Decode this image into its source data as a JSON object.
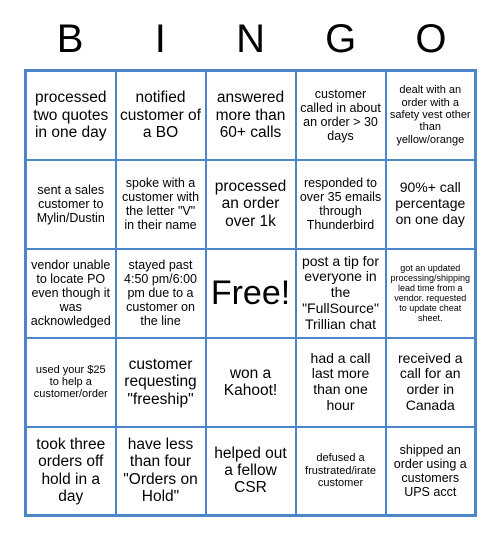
{
  "card": {
    "title": "BINGO",
    "header_letters": [
      "B",
      "I",
      "N",
      "G",
      "O"
    ],
    "border_color": "#4a86c8",
    "text_color": "#000000",
    "background_color": "#ffffff",
    "rows": 5,
    "columns": 5,
    "cells": [
      [
        {
          "text": "processed two quotes in one day",
          "size": "lg"
        },
        {
          "text": "notified customer of a BO",
          "size": "lg"
        },
        {
          "text": "answered more than 60+ calls",
          "size": "lg"
        },
        {
          "text": "customer called in about an order > 30 days",
          "size": "sm"
        },
        {
          "text": "dealt with an order with a safety vest other than yellow/orange",
          "size": "xs"
        }
      ],
      [
        {
          "text": "sent a sales customer to Mylin/Dustin",
          "size": "sm"
        },
        {
          "text": "spoke with a customer with the letter \"V\" in their name",
          "size": "sm"
        },
        {
          "text": "processed an order over 1k",
          "size": "lg"
        },
        {
          "text": "responded to over 35 emails through Thunderbird",
          "size": "sm"
        },
        {
          "text": "90%+ call percentage on one day",
          "size": "md"
        }
      ],
      [
        {
          "text": "vendor unable to locate PO even though it was acknowledged",
          "size": "sm"
        },
        {
          "text": "stayed past 4:50 pm/6:00 pm due to a customer on the line",
          "size": "sm"
        },
        {
          "text": "Free!",
          "size": "xl"
        },
        {
          "text": "post a tip for everyone in the \"FullSource\" Trillian chat",
          "size": "md"
        },
        {
          "text": "got an updated processing/shipping lead time from a vendor. requested to update cheat sheet.",
          "size": "xxs"
        }
      ],
      [
        {
          "text": "used your $25 to help a customer/order",
          "size": "xs"
        },
        {
          "text": "customer requesting \"freeship\"",
          "size": "lg"
        },
        {
          "text": "won a Kahoot!",
          "size": "lg"
        },
        {
          "text": "had a call last more than one hour",
          "size": "md"
        },
        {
          "text": "received a call for an order in Canada",
          "size": "md"
        }
      ],
      [
        {
          "text": "took three orders off hold in a day",
          "size": "lg"
        },
        {
          "text": "have less than four \"Orders on Hold\"",
          "size": "lg"
        },
        {
          "text": "helped out a fellow CSR",
          "size": "lg"
        },
        {
          "text": "defused a frustrated/irate customer",
          "size": "xs"
        },
        {
          "text": "shipped an order using a customers UPS acct",
          "size": "sm"
        }
      ]
    ]
  }
}
